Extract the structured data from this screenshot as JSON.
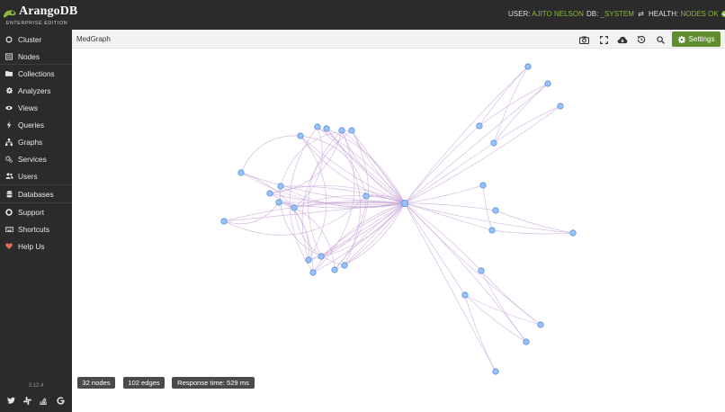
{
  "header": {
    "brand_name": "ArangoDB",
    "brand_edition": "ENTERPRISE EDITION",
    "user_label": "USER:",
    "user_value": "AJITO NELSON",
    "db_label": "DB:",
    "db_value": "_SYSTEM",
    "health_label": "HEALTH:",
    "health_value": "NODES OK",
    "accent_color": "#8cb83c"
  },
  "sidebar": {
    "items": [
      {
        "label": "Cluster",
        "icon": "circle-icon"
      },
      {
        "label": "Nodes",
        "icon": "server-icon"
      },
      {
        "label": "Collections",
        "icon": "folder-icon"
      },
      {
        "label": "Analyzers",
        "icon": "gear-icon"
      },
      {
        "label": "Views",
        "icon": "eye-icon"
      },
      {
        "label": "Queries",
        "icon": "bolt-icon"
      },
      {
        "label": "Graphs",
        "icon": "sitemap-icon"
      },
      {
        "label": "Services",
        "icon": "cogs-icon"
      },
      {
        "label": "Users",
        "icon": "users-icon"
      },
      {
        "label": "Databases",
        "icon": "database-icon"
      },
      {
        "label": "Support",
        "icon": "lifebuoy-icon"
      },
      {
        "label": "Shortcuts",
        "icon": "keyboard-icon"
      },
      {
        "label": "Help Us",
        "icon": "heart-icon"
      }
    ],
    "version": "3.12.4",
    "social": [
      "twitter-icon",
      "slack-icon",
      "stackoverflow-icon",
      "google-icon"
    ]
  },
  "graph": {
    "title": "MedGraph",
    "settings_label": "Settings",
    "node_color": "#97c2fc",
    "edge_color": "#c9a8d8",
    "stats": {
      "nodes": "32 nodes",
      "edges": "102 edges",
      "response": "Response time: 529 ms"
    }
  }
}
